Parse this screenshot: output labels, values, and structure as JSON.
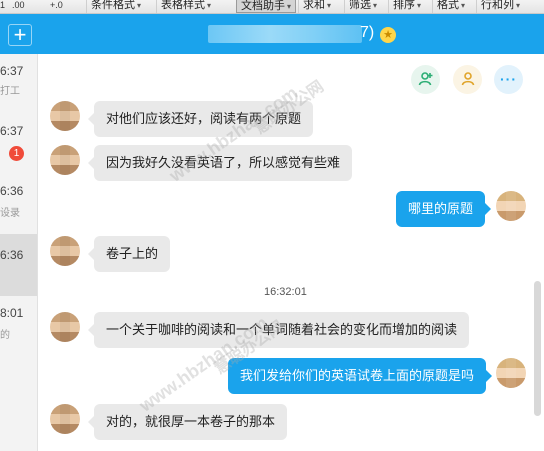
{
  "ribbon": {
    "left_glyphs": [
      "1",
      ".00",
      "+.0"
    ],
    "items": [
      {
        "label": "条件格式",
        "caret": true
      },
      {
        "label": "表格样式",
        "caret": true
      },
      {
        "label": "文档助手",
        "caret": true
      },
      {
        "label": "求和",
        "caret": true
      },
      {
        "label": "筛选",
        "caret": true
      },
      {
        "label": "排序",
        "caret": true
      },
      {
        "label": "格式",
        "caret": true
      },
      {
        "label": "行和列",
        "caret": true
      }
    ],
    "caret_glyph": "▾"
  },
  "titlebar": {
    "add_label": "+",
    "title_suffix": "7)",
    "badge_glyph": "★"
  },
  "conversations": [
    {
      "time": "6:37",
      "preview": "打工"
    },
    {
      "time": "6:37",
      "preview": "",
      "badge": "1"
    },
    {
      "time": "6:36",
      "preview": "设录"
    },
    {
      "time": "6:36",
      "preview": ""
    },
    {
      "time": "8:01",
      "preview": "的"
    }
  ],
  "chat": {
    "actions": {
      "more_label": "···"
    },
    "messages": [
      {
        "dir": "in",
        "text": "对他们应该还好，阅读有两个原题"
      },
      {
        "dir": "in",
        "text": "因为我好久没看英语了，所以感觉有些难"
      },
      {
        "dir": "out",
        "text": "哪里的原题"
      },
      {
        "dir": "in",
        "text": "卷子上的"
      },
      {
        "dir": "in",
        "text": "一个关于咖啡的阅读和一个单词随着社会的变化而增加的阅读"
      },
      {
        "dir": "out",
        "text": "我们发给你们的英语试卷上面的原题是吗"
      },
      {
        "dir": "in",
        "text": "对的，就很厚一本卷子的那本"
      }
    ],
    "timestamp": "16:32:01"
  },
  "watermark": {
    "text": "www.hbzhan.com",
    "brand": "慧聪办公网"
  },
  "colors": {
    "accent": "#1aa3ec",
    "bubble_in": "#e9e9e9",
    "badge": "#f04b3a"
  }
}
